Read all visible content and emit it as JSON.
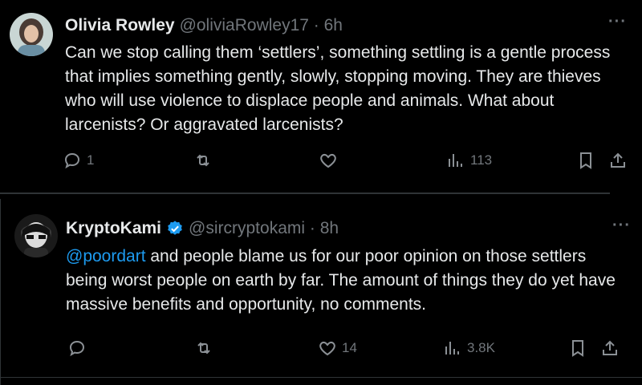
{
  "tweets": [
    {
      "name": "Olivia Rowley",
      "handle": "@oliviaRowley17 · 6h",
      "text": "Can we stop calling them ‘settlers’, something settling is a gentle process that implies something gently, slowly, stopping moving. They are thieves who will use violence to displace people and animals. What about larcenists? Or aggravated larcenists?",
      "more": "···",
      "replies": "1",
      "retweets": "",
      "likes": "",
      "views": "113"
    },
    {
      "name": "KryptoKami",
      "handle": "@sircryptokami · 8h",
      "mention": "@poordart",
      "text": " and people blame us for our poor opinion on those settlers being worst people on earth by far. The amount of things they do yet have massive benefits and opportunity, no comments.",
      "more": "···",
      "replies": "",
      "retweets": "",
      "likes": "14",
      "views": "3.8K",
      "verified": true
    }
  ],
  "colors": {
    "background": "#000000",
    "text": "#e7e9ea",
    "secondary": "#71767b",
    "accent": "#1d9bf0",
    "divider": "#2f3336"
  }
}
